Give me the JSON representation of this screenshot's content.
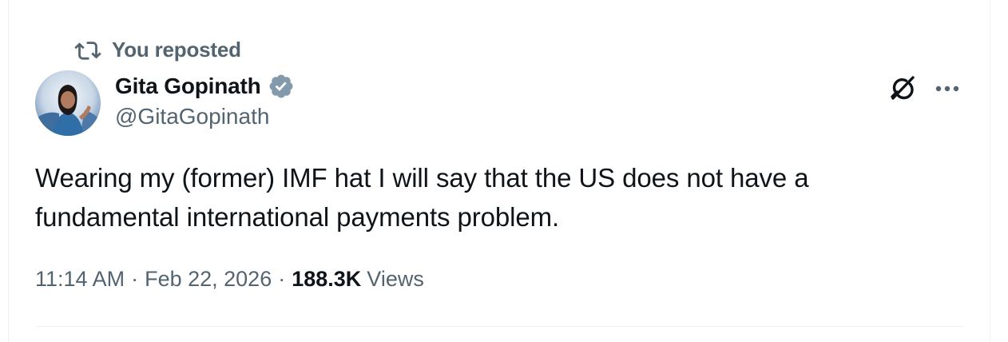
{
  "repost": {
    "label": "You reposted",
    "icon": "repost-icon"
  },
  "author": {
    "display_name": "Gita Gopinath",
    "handle": "@GitaGopinath",
    "verified": true,
    "verified_color": "#829aab"
  },
  "tweet": {
    "text": "Wearing my (former) IMF hat I will say that the US does not have a fundamental international payments problem."
  },
  "meta": {
    "time": "11:14 AM",
    "separator": "·",
    "date": "Feb 22, 2026",
    "views_count": "188.3K",
    "views_label": "Views"
  },
  "icons": {
    "grok": "grok-icon",
    "more": "more-icon"
  },
  "colors": {
    "text_primary": "#0f1419",
    "text_secondary": "#536471",
    "divider": "#eff3f4"
  }
}
